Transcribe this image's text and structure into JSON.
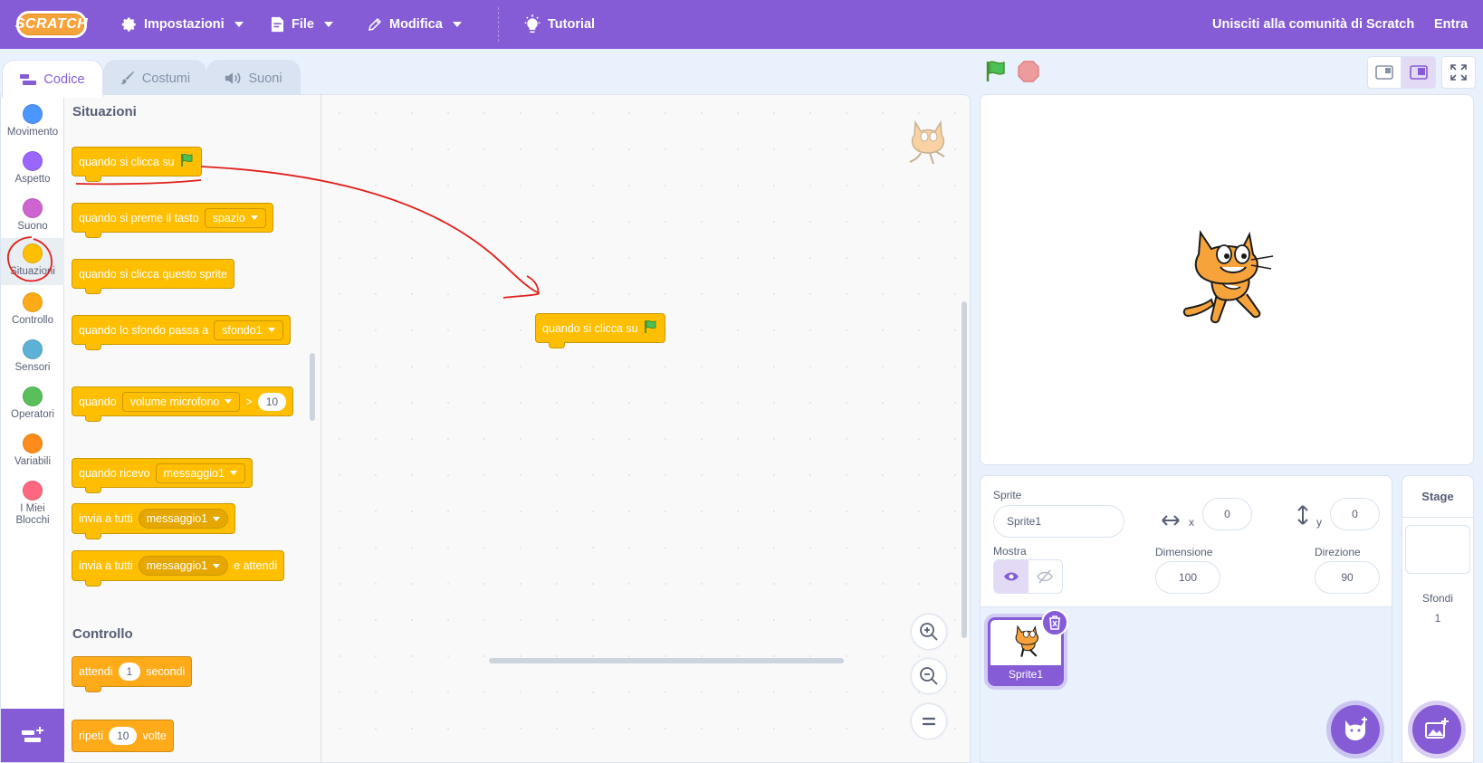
{
  "menubar": {
    "logo": "SCRATCH",
    "settings": "Impostazioni",
    "file": "File",
    "edit": "Modifica",
    "tutorial": "Tutorial",
    "join": "Unisciti alla comunità di Scratch",
    "signin": "Entra"
  },
  "tabs": {
    "code": "Codice",
    "costumes": "Costumi",
    "sounds": "Suoni"
  },
  "categories": [
    {
      "label": "Movimento",
      "color": "#4c97ff"
    },
    {
      "label": "Aspetto",
      "color": "#9966ff"
    },
    {
      "label": "Suono",
      "color": "#cf63cf"
    },
    {
      "label": "Situazioni",
      "color": "#ffbf00"
    },
    {
      "label": "Controllo",
      "color": "#ffab19"
    },
    {
      "label": "Sensori",
      "color": "#5cb1d6"
    },
    {
      "label": "Operatori",
      "color": "#59c059"
    },
    {
      "label": "Variabili",
      "color": "#ff8c1a"
    },
    {
      "label": "I Miei Blocchi",
      "color": "#ff6680"
    }
  ],
  "palette": {
    "events_title": "Situazioni",
    "control_title": "Controllo",
    "b_flag": "quando si clicca su",
    "b_key": "quando si preme il tasto",
    "b_key_dd": "spazio",
    "b_sprite": "quando si clicca questo sprite",
    "b_backdrop": "quando lo sfondo passa a",
    "b_backdrop_dd": "sfondo1",
    "b_when": "quando",
    "b_when_dd": "volume microfono",
    "b_when_op": ">",
    "b_when_val": "10",
    "b_receive": "quando ricevo",
    "b_receive_dd": "messaggio1",
    "b_broadcast": "invia a tutti",
    "b_broadcast_dd": "messaggio1",
    "b_broadcastwait": "invia a tutti",
    "b_broadcastwait_dd": "messaggio1",
    "b_broadcastwait_tail": "e attendi",
    "b_wait": "attendi",
    "b_wait_val": "1",
    "b_wait_tail": "secondi",
    "b_repeat": "ripeti",
    "b_repeat_val": "10",
    "b_repeat_tail": "volte"
  },
  "workspace": {
    "script_block": "quando si clicca su"
  },
  "sprite_info": {
    "sprite_label": "Sprite",
    "sprite_name": "Sprite1",
    "x_label": "x",
    "x_value": "0",
    "y_label": "y",
    "y_value": "0",
    "show_label": "Mostra",
    "size_label": "Dimensione",
    "size_value": "100",
    "direction_label": "Direzione",
    "direction_value": "90"
  },
  "sprite_list": {
    "sprite1": "Sprite1"
  },
  "stage_panel": {
    "title": "Stage",
    "backdrops_label": "Sfondi",
    "backdrops_count": "1"
  },
  "colors": {
    "accent": "#855cd6",
    "events": "#ffbf00",
    "annotation": "#e0201c"
  }
}
